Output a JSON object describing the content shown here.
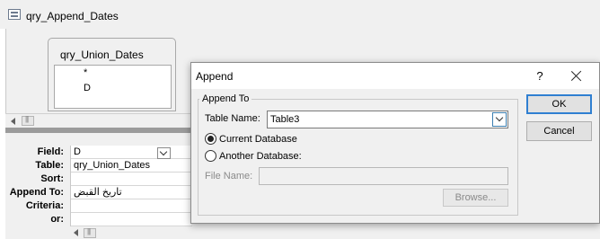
{
  "window": {
    "title": "qry_Append_Dates",
    "icon": "query-icon"
  },
  "field_list": {
    "title": "qry_Union_Dates",
    "items": [
      "*",
      "D"
    ]
  },
  "grid": {
    "row_labels": [
      "Field:",
      "Table:",
      "Sort:",
      "Append To:",
      "Criteria:",
      "or:"
    ],
    "column1": {
      "field": "D",
      "table": "qry_Union_Dates",
      "sort": "",
      "append_to": "تاريخ القبض",
      "criteria": "",
      "or": ""
    }
  },
  "dialog": {
    "title": "Append",
    "help_label": "?",
    "group_label": "Append To",
    "table_name_label": "Table Name:",
    "table_name_value": "Table3",
    "radio_current_label": "Current Database",
    "radio_current_selected": true,
    "radio_another_label": "Another Database:",
    "file_name_label": "File Name:",
    "file_name_value": "",
    "browse_label": "Browse...",
    "ok_label": "OK",
    "cancel_label": "Cancel"
  },
  "colors": {
    "ok_border": "#2f7fd1",
    "dropdown_focus": "#3c7fb1"
  }
}
